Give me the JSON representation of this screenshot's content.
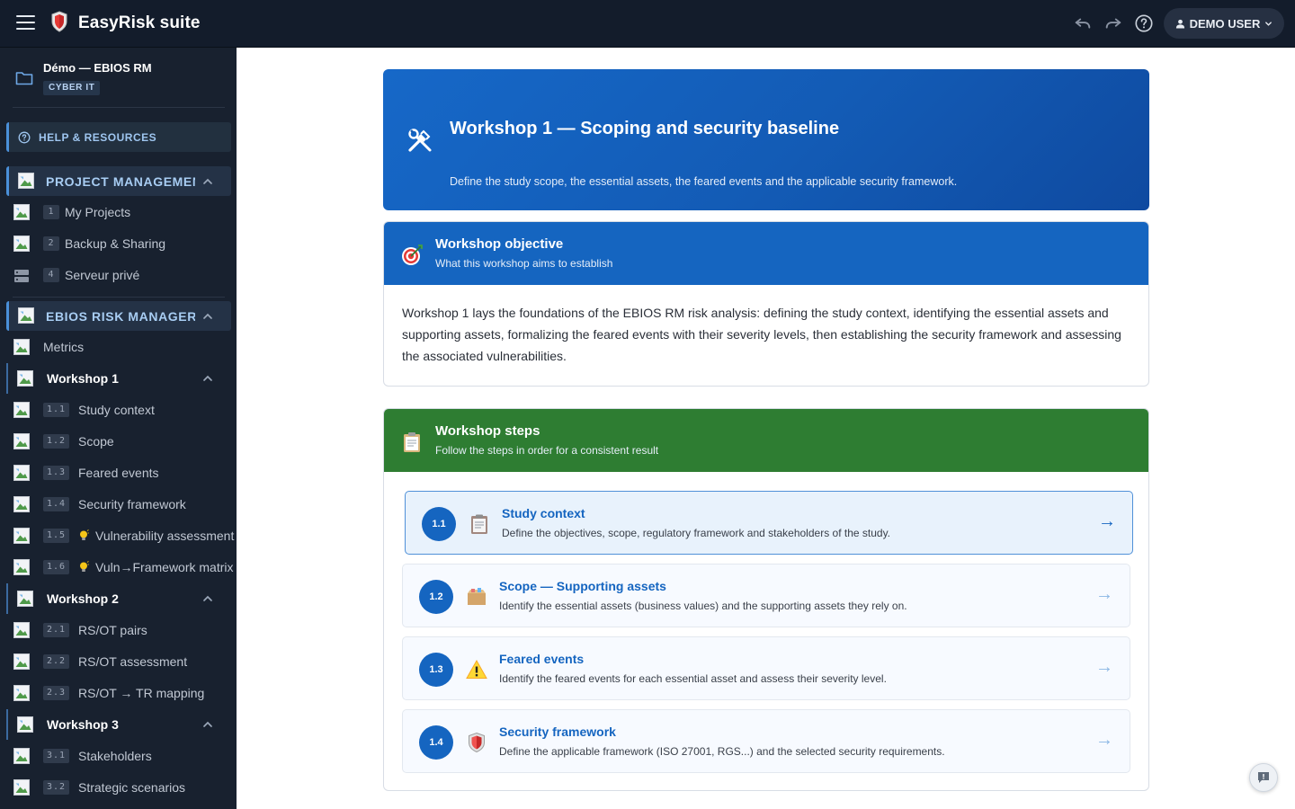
{
  "app": {
    "title": "EasyRisk suite"
  },
  "user": {
    "label": "DEMO USER"
  },
  "sidebar": {
    "project_name": "Démo — EBIOS RM",
    "project_tag": "CYBER IT",
    "help_label": "HELP & RESOURCES",
    "project_management": {
      "label": "PROJECT MANAGEMEN",
      "items": [
        {
          "num": "1",
          "label": "My Projects"
        },
        {
          "num": "2",
          "label": "Backup & Sharing"
        },
        {
          "num": "4",
          "label": "Serveur privé"
        }
      ]
    },
    "ebios": {
      "label": "EBIOS RISK MANAGER",
      "metrics_label": "Metrics"
    },
    "workshop1": {
      "label": "Workshop 1",
      "items": [
        {
          "num": "1.1",
          "label": "Study context"
        },
        {
          "num": "1.2",
          "label": "Scope"
        },
        {
          "num": "1.3",
          "label": "Feared events"
        },
        {
          "num": "1.4",
          "label": "Security framework"
        },
        {
          "num": "1.5",
          "label": "Vulnerability assessment"
        },
        {
          "num": "1.6",
          "label": "Vuln→Framework matrix"
        }
      ]
    },
    "workshop2": {
      "label": "Workshop 2",
      "items": [
        {
          "num": "2.1",
          "label": "RS/OT pairs"
        },
        {
          "num": "2.2",
          "label": "RS/OT assessment"
        },
        {
          "num": "2.3",
          "label": "RS/OT → TR mapping"
        }
      ]
    },
    "workshop3": {
      "label": "Workshop 3",
      "items": [
        {
          "num": "3.1",
          "label": "Stakeholders"
        },
        {
          "num": "3.2",
          "label": "Strategic scenarios"
        }
      ]
    }
  },
  "hero": {
    "title": "Workshop 1 — Scoping and security baseline",
    "description": "Define the study scope, the essential assets, the feared events and the applicable security framework."
  },
  "objective": {
    "title": "Workshop objective",
    "subtitle": "What this workshop aims to establish",
    "body": "Workshop 1 lays the foundations of the EBIOS RM risk analysis: defining the study context, identifying the essential assets and supporting assets, formalizing the feared events with their severity levels, then establishing the security framework and assessing the associated vulnerabilities."
  },
  "steps_card": {
    "title": "Workshop steps",
    "subtitle": "Follow the steps in order for a consistent result",
    "steps": [
      {
        "num": "1.1",
        "icon": "clipboard-icon",
        "title": "Study context",
        "description": "Define the objectives, scope, regulatory framework and stakeholders of the study.",
        "arrow": "→"
      },
      {
        "num": "1.2",
        "icon": "box-icon",
        "title": "Scope — Supporting assets",
        "description": "Identify the essential assets (business values) and the supporting assets they rely on.",
        "arrow": "→"
      },
      {
        "num": "1.3",
        "icon": "warning-icon",
        "title": "Feared events",
        "description": "Identify the feared events for each essential asset and assess their severity level.",
        "arrow": "→"
      },
      {
        "num": "1.4",
        "icon": "shield-icon",
        "title": "Security framework",
        "description": "Define the applicable framework (ISO 27001, RGS...) and the selected security requirements.",
        "arrow": "→"
      }
    ]
  },
  "colors": {
    "topbar": "#131c2b",
    "sidebar": "#18212f",
    "accent_blue": "#1565c0",
    "steps_header_green": "#2e7d32"
  }
}
